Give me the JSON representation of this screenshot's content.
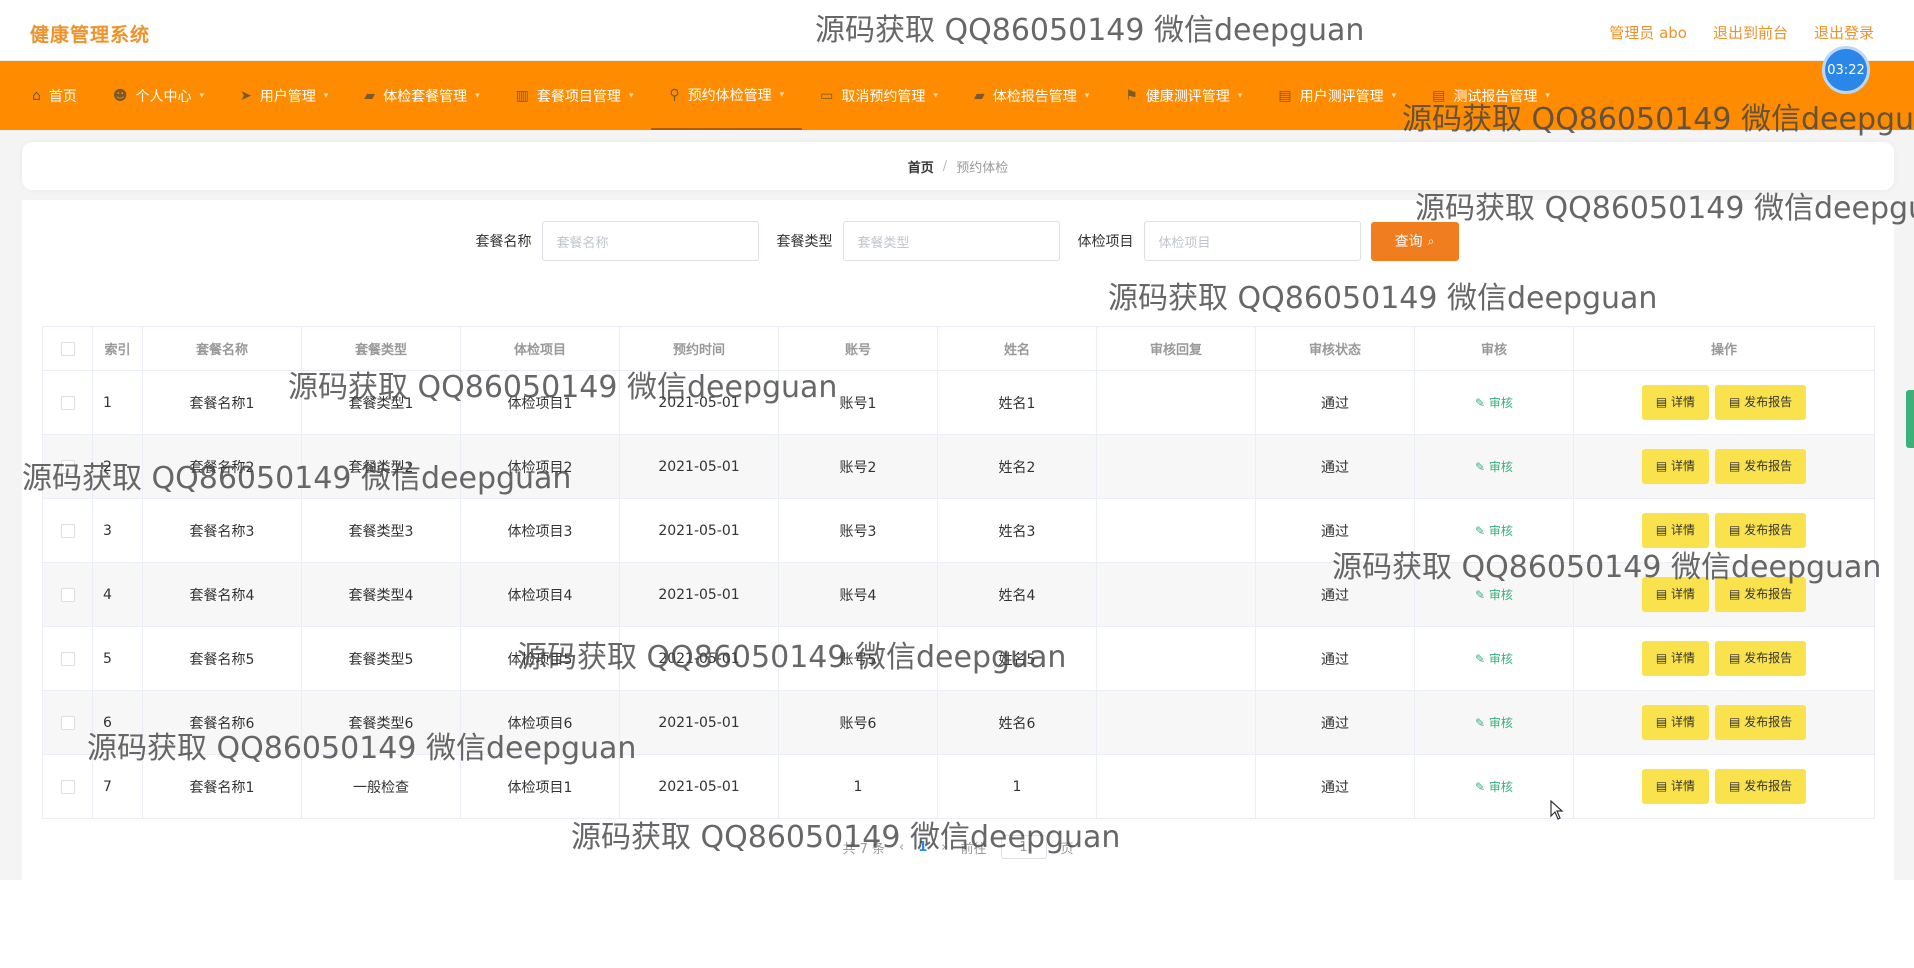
{
  "app": {
    "title": "健康管理系统",
    "top_links": [
      "管理员 abo",
      "退出到前台",
      "退出登录"
    ],
    "clock": "03:22"
  },
  "nav": {
    "items": [
      {
        "label": "首页",
        "icon": "home-icon"
      },
      {
        "label": "个人中心",
        "icon": "user-icon"
      },
      {
        "label": "用户管理",
        "icon": "send-icon"
      },
      {
        "label": "体检套餐管理",
        "icon": "chat-icon"
      },
      {
        "label": "套餐项目管理",
        "icon": "chart-icon"
      },
      {
        "label": "预约体检管理",
        "icon": "pin-icon"
      },
      {
        "label": "取消预约管理",
        "icon": "message-icon"
      },
      {
        "label": "体检报告管理",
        "icon": "chat-icon"
      },
      {
        "label": "健康测评管理",
        "icon": "flag-icon"
      },
      {
        "label": "用户测评管理",
        "icon": "doc-icon"
      },
      {
        "label": "测试报告管理",
        "icon": "doc-icon"
      }
    ],
    "active_index": 5
  },
  "breadcrumb": {
    "home": "首页",
    "current": "预约体检"
  },
  "search": {
    "fields": [
      {
        "label": "套餐名称",
        "placeholder": "套餐名称"
      },
      {
        "label": "套餐类型",
        "placeholder": "套餐类型"
      },
      {
        "label": "体检项目",
        "placeholder": "体检项目"
      }
    ],
    "button": "查询"
  },
  "table": {
    "columns": [
      "索引",
      "套餐名称",
      "套餐类型",
      "体检项目",
      "预约时间",
      "账号",
      "姓名",
      "审核回复",
      "审核状态",
      "审核",
      "操作"
    ],
    "rows": [
      {
        "index": "1",
        "name": "套餐名称1",
        "type": "套餐类型1",
        "item": "体检项目1",
        "time": "2021-05-01",
        "account": "账号1",
        "person": "姓名1",
        "reply": "",
        "status": "通过"
      },
      {
        "index": "2",
        "name": "套餐名称2",
        "type": "套餐类型2",
        "item": "体检项目2",
        "time": "2021-05-01",
        "account": "账号2",
        "person": "姓名2",
        "reply": "",
        "status": "通过"
      },
      {
        "index": "3",
        "name": "套餐名称3",
        "type": "套餐类型3",
        "item": "体检项目3",
        "time": "2021-05-01",
        "account": "账号3",
        "person": "姓名3",
        "reply": "",
        "status": "通过"
      },
      {
        "index": "4",
        "name": "套餐名称4",
        "type": "套餐类型4",
        "item": "体检项目4",
        "time": "2021-05-01",
        "account": "账号4",
        "person": "姓名4",
        "reply": "",
        "status": "通过"
      },
      {
        "index": "5",
        "name": "套餐名称5",
        "type": "套餐类型5",
        "item": "体检项目5",
        "time": "2021-05-01",
        "account": "账号5",
        "person": "姓名5",
        "reply": "",
        "status": "通过"
      },
      {
        "index": "6",
        "name": "套餐名称6",
        "type": "套餐类型6",
        "item": "体检项目6",
        "time": "2021-05-01",
        "account": "账号6",
        "person": "姓名6",
        "reply": "",
        "status": "通过"
      },
      {
        "index": "7",
        "name": "套餐名称1",
        "type": "一般检查",
        "item": "体检项目1",
        "time": "2021-05-01",
        "account": "1",
        "person": "1",
        "reply": "",
        "status": "通过"
      }
    ],
    "audit_label": "审核",
    "detail_label": "详情",
    "report_label": "发布报告"
  },
  "pager": {
    "total": "共 7 条",
    "current_page": "1",
    "goto": "前往",
    "goto_value": "1",
    "page_unit": "页"
  },
  "watermark": "源码获取 QQ86050149 微信deepguan",
  "colors": {
    "accent": "#ff8c00",
    "brand_text": "#f0922b",
    "button_yellow": "#f9e24c",
    "audit_green": "#3cae7e"
  }
}
